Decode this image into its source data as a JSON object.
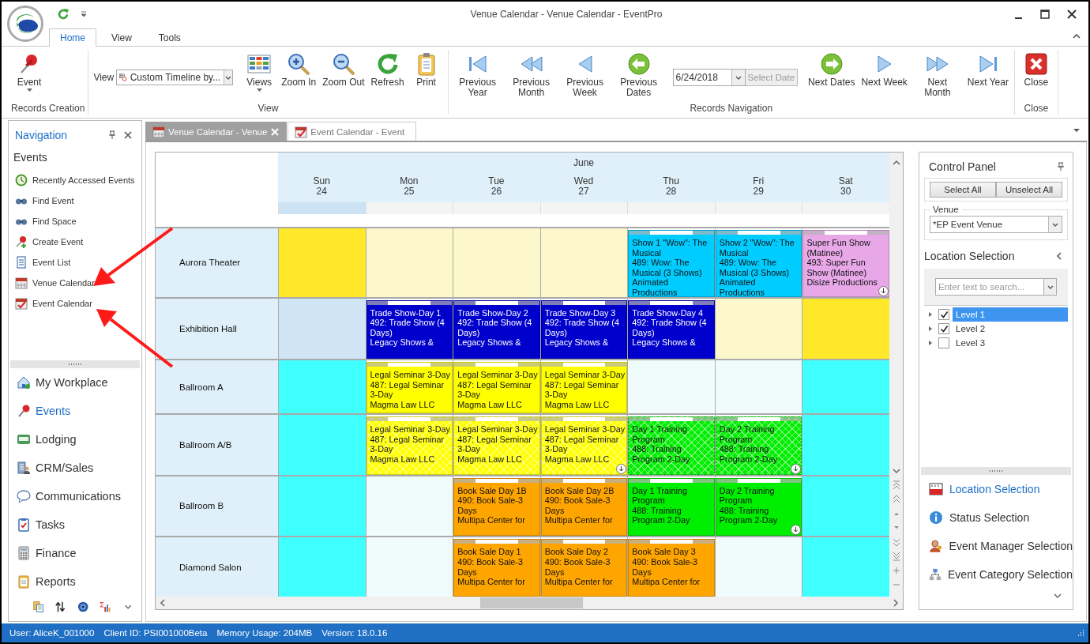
{
  "window": {
    "title": "Venue Calendar - Venue Calendar - EventPro"
  },
  "ribbon_tabs": [
    {
      "label": "Home",
      "selected": true
    },
    {
      "label": "View",
      "selected": false
    },
    {
      "label": "Tools",
      "selected": false
    }
  ],
  "ribbon_groups": [
    {
      "label": "Records Creation",
      "items": [
        {
          "kind": "button",
          "label": "Event",
          "dropdown": true
        }
      ]
    },
    {
      "label": "View",
      "items": [
        {
          "kind": "combo",
          "label": "View",
          "value": "Custom Timeline by..."
        },
        {
          "kind": "button",
          "label": "Views",
          "dropdown": true
        },
        {
          "kind": "button",
          "label": "Zoom In",
          "dropdown": false
        },
        {
          "kind": "button",
          "label": "Zoom Out",
          "dropdown": false
        },
        {
          "kind": "button",
          "label": "Refresh",
          "dropdown": false
        },
        {
          "kind": "button",
          "label": "Print",
          "dropdown": false
        }
      ]
    },
    {
      "label": "Records Navigation",
      "items": [
        {
          "kind": "button",
          "label": "Previous Year",
          "dropdown": false
        },
        {
          "kind": "button",
          "label": "Previous Month",
          "dropdown": false
        },
        {
          "kind": "button",
          "label": "Previous Week",
          "dropdown": false
        },
        {
          "kind": "button",
          "label": "Previous Dates",
          "dropdown": false
        },
        {
          "kind": "date",
          "value": "6/24/2018",
          "action": "Select Date",
          "disabled": true
        },
        {
          "kind": "button",
          "label": "Next Dates",
          "dropdown": false
        },
        {
          "kind": "button",
          "label": "Next Week",
          "dropdown": false
        },
        {
          "kind": "button",
          "label": "Next Month",
          "dropdown": false
        },
        {
          "kind": "button",
          "label": "Next Year",
          "dropdown": false
        }
      ]
    },
    {
      "label": "Close",
      "items": [
        {
          "kind": "button",
          "label": "Close",
          "dropdown": false
        }
      ]
    }
  ],
  "navigation": {
    "title": "Navigation",
    "heading": "Events",
    "items": [
      {
        "label": "Recently Accessed Events"
      },
      {
        "label": "Find Event"
      },
      {
        "label": "Find Space"
      },
      {
        "label": "Create Event"
      },
      {
        "label": "Event List"
      },
      {
        "label": "Venue Calendar"
      },
      {
        "label": "Event Calendar"
      }
    ],
    "sections": [
      {
        "label": "My Workplace",
        "selected": false
      },
      {
        "label": "Events",
        "selected": true
      },
      {
        "label": "Lodging",
        "selected": false
      },
      {
        "label": "CRM/Sales",
        "selected": false
      },
      {
        "label": "Communications",
        "selected": false
      },
      {
        "label": "Tasks",
        "selected": false
      },
      {
        "label": "Finance",
        "selected": false
      },
      {
        "label": "Reports",
        "selected": false
      }
    ]
  },
  "document_tabs": [
    {
      "label": "Venue Calendar - Venue",
      "selected": true
    },
    {
      "label": "Event Calendar - Event",
      "selected": false
    }
  ],
  "calendar": {
    "month": "June",
    "days": [
      {
        "weekday": "Sun",
        "date": "24",
        "selected": true
      },
      {
        "weekday": "Mon",
        "date": "25",
        "selected": false
      },
      {
        "weekday": "Tue",
        "date": "26",
        "selected": false
      },
      {
        "weekday": "Wed",
        "date": "27",
        "selected": false
      },
      {
        "weekday": "Thu",
        "date": "28",
        "selected": false
      },
      {
        "weekday": "Fri",
        "date": "29",
        "selected": false
      },
      {
        "weekday": "Sat",
        "date": "30",
        "selected": false
      }
    ],
    "rows": [
      {
        "location": "Aurora Theater",
        "cells": [
          {
            "color": "#ffe82a"
          },
          {
            "color": "#fcf8cc"
          },
          {
            "color": "#fcf8cc"
          },
          {
            "color": "#fcf8cc"
          },
          {
            "event": {
              "title": "Show 1 \"Wow\": The Musical",
              "booking": "489: Wow: The Musical (3 Shows)",
              "client": "Animated Productions",
              "color": "#00ccff",
              "hatched": false,
              "more": false
            }
          },
          {
            "event": {
              "title": "Show 2 \"Wow\": The Musical",
              "booking": "489: Wow: The Musical (3 Shows)",
              "client": "Animated Productions",
              "color": "#00ccff",
              "hatched": false,
              "more": false
            }
          },
          {
            "event": {
              "title": "Super Fun Show (Matinee)",
              "booking": "493: Super Fun Show (Matinee)",
              "client": "Disize Productions",
              "color": "#e8a8e8",
              "hatched": false,
              "more": true
            }
          }
        ]
      },
      {
        "location": "Exhibition Hall",
        "cells": [
          {
            "color": "#cfe4f5"
          },
          {
            "event": {
              "title": "Trade Show-Day 1",
              "booking": "492: Trade Show (4 Days)",
              "client": "Legacy Shows &",
              "color": "#0000cc",
              "hatched": false,
              "more": false
            }
          },
          {
            "event": {
              "title": "Trade Show-Day 2",
              "booking": "492: Trade Show (4 Days)",
              "client": "Legacy Shows &",
              "color": "#0000cc",
              "hatched": false,
              "more": false
            }
          },
          {
            "event": {
              "title": "Trade Show-Day 3",
              "booking": "492: Trade Show (4 Days)",
              "client": "Legacy Shows &",
              "color": "#0000cc",
              "hatched": false,
              "more": false
            }
          },
          {
            "event": {
              "title": "Trade Show-Day 4",
              "booking": "492: Trade Show (4 Days)",
              "client": "Legacy Shows &",
              "color": "#0000cc",
              "hatched": false,
              "more": false
            }
          },
          {
            "color": "#fcf8cc"
          },
          {
            "color": "#ffe82a"
          }
        ]
      },
      {
        "location": "Ballroom A",
        "cells": [
          {
            "color": "#40ffff"
          },
          {
            "event": {
              "title": "Legal Seminar 3-Day",
              "booking": "487: Legal Seminar 3-Day",
              "client": "Magma Law LLC",
              "color": "#ffff00",
              "hatched": false,
              "more": false
            }
          },
          {
            "event": {
              "title": "Legal Seminar 3-Day",
              "booking": "487: Legal Seminar 3-Day",
              "client": "Magma Law LLC",
              "color": "#ffff00",
              "hatched": false,
              "more": false
            }
          },
          {
            "event": {
              "title": "Legal Seminar 3-Day",
              "booking": "487: Legal Seminar 3-Day",
              "client": "Magma Law LLC",
              "color": "#ffff00",
              "hatched": false,
              "more": false
            }
          },
          {
            "color": "#f0fcfc"
          },
          {
            "color": "#f0fcfc"
          },
          {
            "color": "#40ffff"
          }
        ]
      },
      {
        "location": "Ballroom A/B",
        "cells": [
          {
            "color": "#40ffff"
          },
          {
            "event": {
              "title": "Legal Seminar 3-Day",
              "booking": "487: Legal Seminar 3-Day",
              "client": "Magma Law LLC",
              "color": "#ffff00",
              "hatched": true,
              "more": false
            }
          },
          {
            "event": {
              "title": "Legal Seminar 3-Day",
              "booking": "487: Legal Seminar 3-Day",
              "client": "Magma Law LLC",
              "color": "#ffff00",
              "hatched": true,
              "more": false
            }
          },
          {
            "event": {
              "title": "Legal Seminar 3-Day",
              "booking": "487: Legal Seminar 3-Day",
              "client": "Magma Law LLC",
              "color": "#ffff00",
              "hatched": true,
              "more": true
            }
          },
          {
            "event": {
              "title": "Day 1 Training Program",
              "booking": "488: Training Program 2-Day",
              "color": "#00ee00",
              "hatched": true,
              "more": false
            }
          },
          {
            "event": {
              "title": "Day 2 Training Program",
              "booking": "488: Training Program 2-Day",
              "color": "#00ee00",
              "hatched": true,
              "more": true
            }
          },
          {
            "color": "#40ffff"
          }
        ]
      },
      {
        "location": "Ballroom B",
        "cells": [
          {
            "color": "#40ffff"
          },
          {
            "color": "#f0fcfc"
          },
          {
            "event": {
              "title": "Book Sale Day 1B",
              "booking": "490: Book Sale-3 Days",
              "client": "Multipa Center for",
              "color": "#ffa500",
              "hatched": false,
              "more": false
            }
          },
          {
            "event": {
              "title": "Book Sale Day 2B",
              "booking": "490: Book Sale-3 Days",
              "client": "Multipa Center for",
              "color": "#ffa500",
              "hatched": false,
              "more": false
            }
          },
          {
            "event": {
              "title": "Day 1 Training Program",
              "booking": "488: Training Program 2-Day",
              "color": "#00ee00",
              "hatched": false,
              "more": false
            }
          },
          {
            "event": {
              "title": "Day 2 Training Program",
              "booking": "488: Training Program 2-Day",
              "color": "#00ee00",
              "hatched": false,
              "more": true
            }
          },
          {
            "color": "#40ffff"
          }
        ]
      },
      {
        "location": "Diamond Salon",
        "cells": [
          {
            "color": "#40ffff"
          },
          {
            "color": "#f0fcfc"
          },
          {
            "event": {
              "title": "Book Sale Day 1",
              "booking": "490: Book Sale-3 Days",
              "client": "Multipa Center for",
              "color": "#ffa500",
              "hatched": false,
              "more": false
            }
          },
          {
            "event": {
              "title": "Book Sale Day 2",
              "booking": "490: Book Sale-3 Days",
              "client": "Multipa Center for",
              "color": "#ffa500",
              "hatched": false,
              "more": false
            }
          },
          {
            "event": {
              "title": "Book Sale Day 3",
              "booking": "490: Book Sale-3 Days",
              "client": "Multipa Center for",
              "color": "#ffa500",
              "hatched": false,
              "more": false
            }
          },
          {
            "color": "#f0fcfc"
          },
          {
            "color": "#40ffff"
          }
        ]
      }
    ]
  },
  "control_panel": {
    "title": "Control Panel",
    "buttons": [
      "Select All",
      "Unselect All"
    ],
    "venue": {
      "label": "Venue",
      "value": "*EP Event Venue"
    },
    "location_selection": {
      "title": "Location Selection",
      "search": {
        "placeholder": "Enter text to search..."
      },
      "tree": [
        {
          "label": "Level 1",
          "checked": true,
          "selected": true,
          "expanded": false
        },
        {
          "label": "Level 2",
          "checked": true,
          "selected": false,
          "expanded": false
        },
        {
          "label": "Level 3",
          "checked": false,
          "selected": false,
          "expanded": false
        }
      ]
    },
    "sections": [
      {
        "label": "Location Selection",
        "selected": true
      },
      {
        "label": "Status Selection",
        "selected": false
      },
      {
        "label": "Event Manager Selection",
        "selected": false
      },
      {
        "label": "Event Category Selection",
        "selected": false
      }
    ]
  },
  "status_bar": [
    "User: AliceK_001000",
    "Client ID: PSI001000Beta",
    "Memory Usage: 204MB",
    "Version: 18.0.16"
  ]
}
